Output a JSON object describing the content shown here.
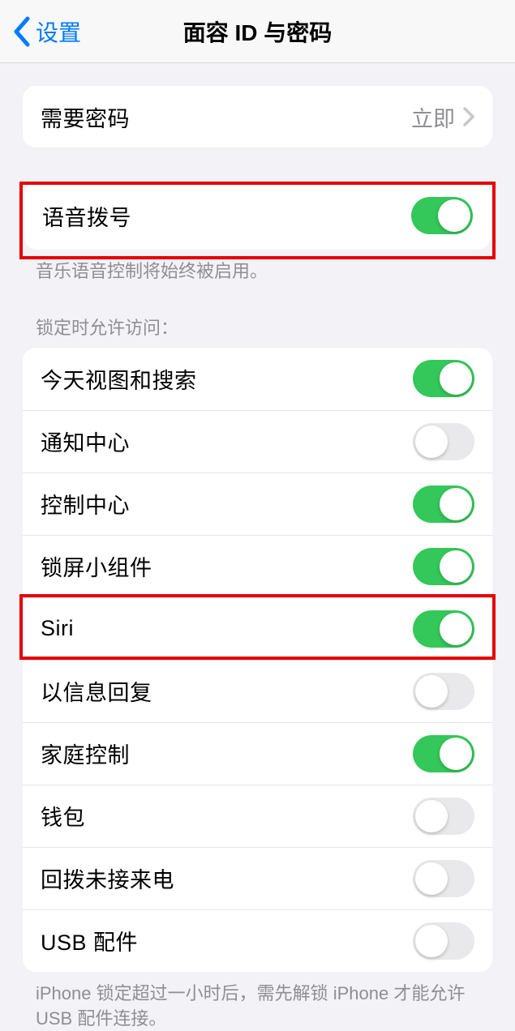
{
  "header": {
    "back_label": "设置",
    "title": "面容 ID 与密码"
  },
  "require_passcode": {
    "label": "需要密码",
    "value": "立即"
  },
  "voice_dial": {
    "label": "语音拨号",
    "footer": "音乐语音控制将始终被启用。"
  },
  "access_locked": {
    "header": "锁定时允许访问：",
    "items": [
      {
        "label": "今天视图和搜索",
        "on": true
      },
      {
        "label": "通知中心",
        "on": false
      },
      {
        "label": "控制中心",
        "on": true
      },
      {
        "label": "锁屏小组件",
        "on": true
      },
      {
        "label": "Siri",
        "on": true
      },
      {
        "label": "以信息回复",
        "on": false
      },
      {
        "label": "家庭控制",
        "on": true
      },
      {
        "label": "钱包",
        "on": false
      },
      {
        "label": "回拨未接来电",
        "on": false
      },
      {
        "label": "USB 配件",
        "on": false
      }
    ],
    "footer": "iPhone 锁定超过一小时后，需先解锁 iPhone 才能允许 USB 配件连接。"
  }
}
